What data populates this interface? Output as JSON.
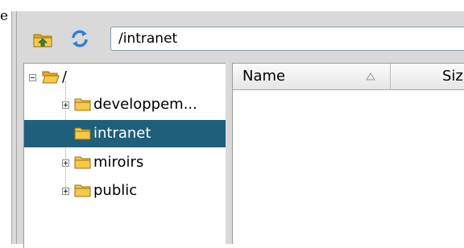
{
  "edge_text": "e",
  "toolbar": {
    "up_icon": "folder-up-icon",
    "refresh_icon": "refresh-icon",
    "path_value": "/intranet"
  },
  "tree": {
    "root": {
      "label": "/",
      "expanded": true
    },
    "items": [
      {
        "label": "developpem...",
        "expandable": true,
        "selected": false
      },
      {
        "label": "intranet",
        "expandable": false,
        "selected": true
      },
      {
        "label": "miroirs",
        "expandable": true,
        "selected": false
      },
      {
        "label": "public",
        "expandable": true,
        "selected": false
      }
    ]
  },
  "file_list": {
    "columns": [
      {
        "label": "Name",
        "sorted": "ascending"
      },
      {
        "label": "Siz"
      }
    ],
    "rows": []
  },
  "colors": {
    "selection": "#1f5f7b",
    "folder": "#f2b92d",
    "window_bg": "#d9d9d9"
  }
}
